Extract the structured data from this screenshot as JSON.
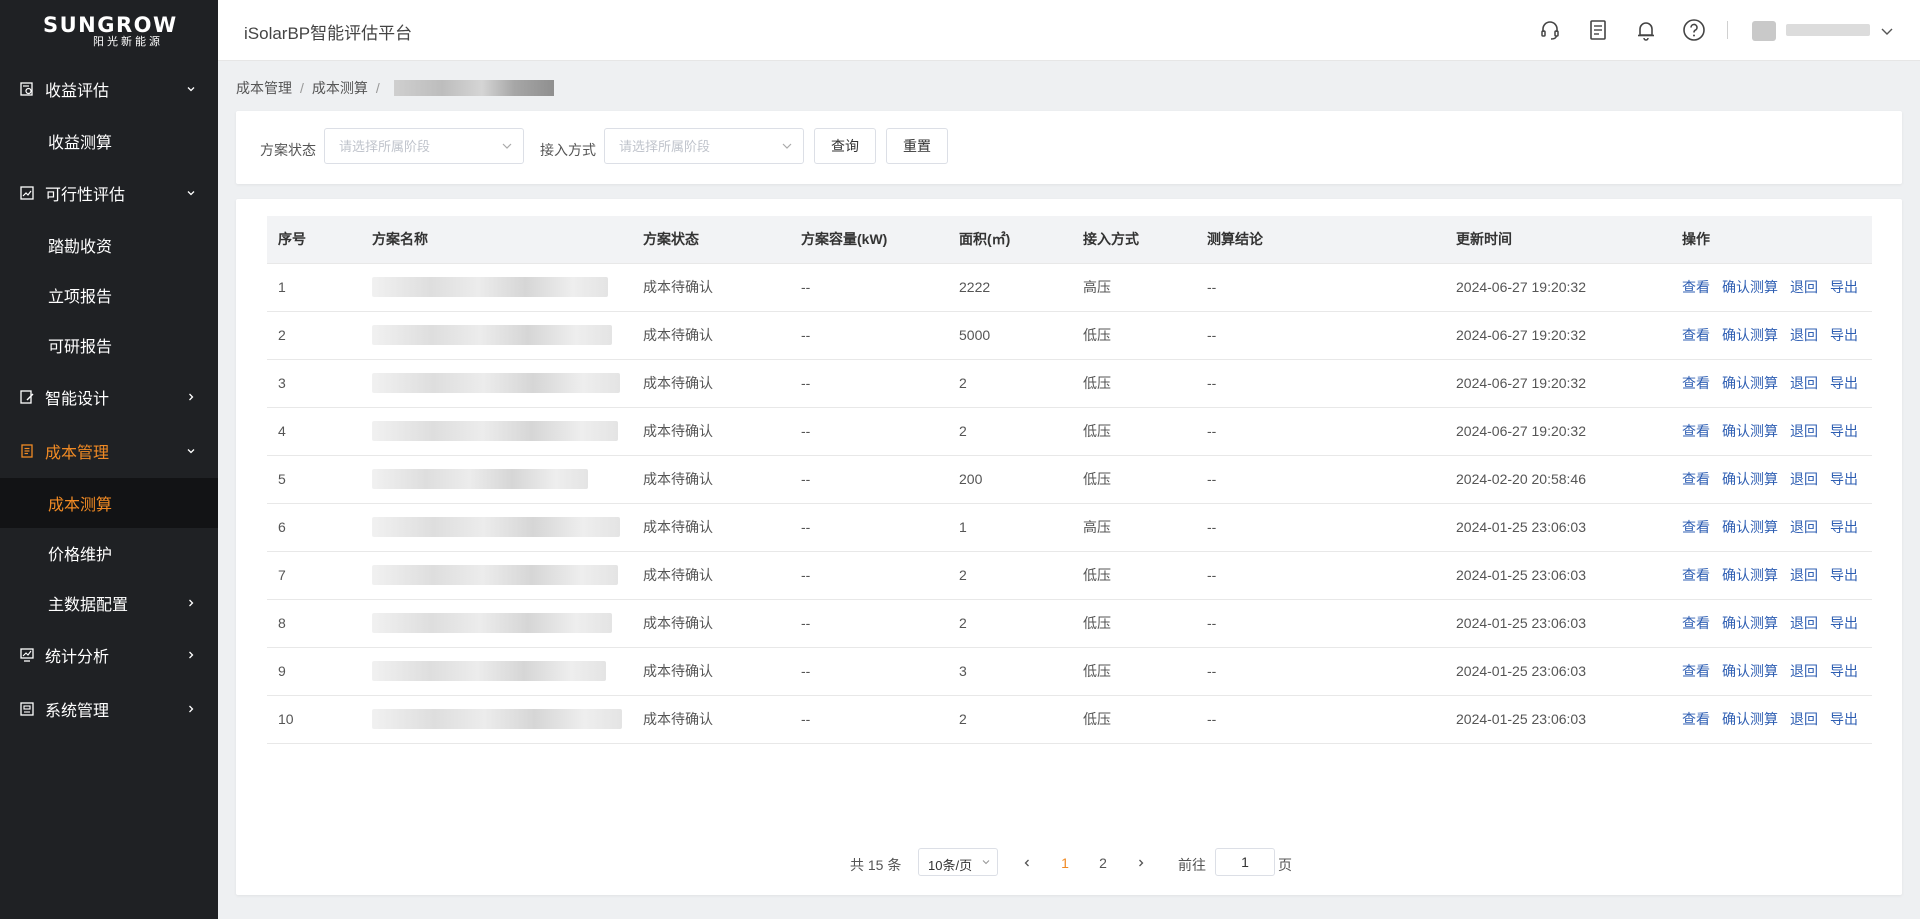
{
  "brand": {
    "name": "SUNGROW",
    "sub": "阳光新能源"
  },
  "header": {
    "title": "iSolarBP智能评估平台"
  },
  "sidebar": {
    "items": [
      {
        "label": "收益评估",
        "expanded": true,
        "children": [
          {
            "label": "收益测算"
          }
        ]
      },
      {
        "label": "可行性评估",
        "expanded": true,
        "children": [
          {
            "label": "踏勘收资"
          },
          {
            "label": "立项报告"
          },
          {
            "label": "可研报告"
          }
        ]
      },
      {
        "label": "智能设计",
        "expanded": false
      },
      {
        "label": "成本管理",
        "expanded": true,
        "active": true,
        "children": [
          {
            "label": "成本测算",
            "active": true
          },
          {
            "label": "价格维护"
          },
          {
            "label": "主数据配置"
          }
        ]
      },
      {
        "label": "统计分析",
        "expanded": false
      },
      {
        "label": "系统管理",
        "expanded": false
      }
    ]
  },
  "breadcrumb": {
    "level1": "成本管理",
    "level2": "成本测算",
    "sep": "/"
  },
  "filters": {
    "status_label": "方案状态",
    "status_placeholder": "请选择所属阶段",
    "access_label": "接入方式",
    "access_placeholder": "请选择所属阶段",
    "search_button": "查询",
    "reset_button": "重置"
  },
  "table": {
    "columns": [
      "序号",
      "方案名称",
      "方案状态",
      "方案容量(kW)",
      "面积(㎡)",
      "接入方式",
      "测算结论",
      "更新时间",
      "操作"
    ],
    "rows": [
      {
        "index": "1",
        "status": "成本待确认",
        "capacity": "--",
        "area": "2222",
        "access": "高压",
        "conclusion": "--",
        "updated": "2024-06-27 19:20:32"
      },
      {
        "index": "2",
        "status": "成本待确认",
        "capacity": "--",
        "area": "5000",
        "access": "低压",
        "conclusion": "--",
        "updated": "2024-06-27 19:20:32"
      },
      {
        "index": "3",
        "status": "成本待确认",
        "capacity": "--",
        "area": "2",
        "access": "低压",
        "conclusion": "--",
        "updated": "2024-06-27 19:20:32"
      },
      {
        "index": "4",
        "status": "成本待确认",
        "capacity": "--",
        "area": "2",
        "access": "低压",
        "conclusion": "--",
        "updated": "2024-06-27 19:20:32"
      },
      {
        "index": "5",
        "status": "成本待确认",
        "capacity": "--",
        "area": "200",
        "access": "低压",
        "conclusion": "--",
        "updated": "2024-02-20 20:58:46"
      },
      {
        "index": "6",
        "status": "成本待确认",
        "capacity": "--",
        "area": "1",
        "access": "高压",
        "conclusion": "--",
        "updated": "2024-01-25 23:06:03"
      },
      {
        "index": "7",
        "status": "成本待确认",
        "capacity": "--",
        "area": "2",
        "access": "低压",
        "conclusion": "--",
        "updated": "2024-01-25 23:06:03"
      },
      {
        "index": "8",
        "status": "成本待确认",
        "capacity": "--",
        "area": "2",
        "access": "低压",
        "conclusion": "--",
        "updated": "2024-01-25 23:06:03"
      },
      {
        "index": "9",
        "status": "成本待确认",
        "capacity": "--",
        "area": "3",
        "access": "低压",
        "conclusion": "--",
        "updated": "2024-01-25 23:06:03"
      },
      {
        "index": "10",
        "status": "成本待确认",
        "capacity": "--",
        "area": "2",
        "access": "低压",
        "conclusion": "--",
        "updated": "2024-01-25 23:06:03"
      }
    ],
    "actions": {
      "view": "查看",
      "confirm": "确认测算",
      "return": "退回",
      "export": "导出"
    }
  },
  "pagination": {
    "total_text": "共 15 条",
    "page_size": "10条/页",
    "pages": [
      "1",
      "2"
    ],
    "current_page": "1",
    "goto_label": "前往",
    "goto_value": "1",
    "page_suffix": "页"
  },
  "colors": {
    "accent": "#f08a24",
    "link": "#2f5fb3",
    "sidebar_bg": "#1f2124"
  }
}
